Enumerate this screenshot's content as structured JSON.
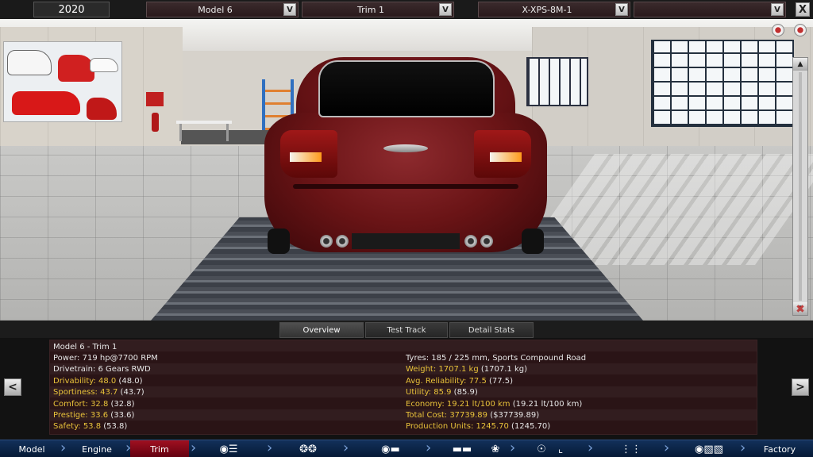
{
  "topbar": {
    "year": "2020",
    "model_select": "Model 6",
    "trim_select": "Trim 1",
    "engine_select": "X-XPS-8M-1",
    "extra_select": "",
    "dropdown_button": "V",
    "close_button": "X"
  },
  "tabs": [
    {
      "label": "Overview",
      "active": true
    },
    {
      "label": "Test Track",
      "active": false
    },
    {
      "label": "Detail Stats",
      "active": false
    }
  ],
  "stats": {
    "title": "Model 6 - Trim 1",
    "left": [
      {
        "label": "Power: ",
        "value": "719 hp@7700 RPM",
        "paren": "",
        "highlight": false
      },
      {
        "label": "Drivetrain: ",
        "value": "6 Gears RWD",
        "paren": "",
        "highlight": false
      },
      {
        "label": "Drivability: ",
        "value": "48.0",
        "paren": " (48.0)",
        "highlight": true
      },
      {
        "label": "Sportiness: ",
        "value": "43.7",
        "paren": " (43.7)",
        "highlight": true
      },
      {
        "label": "Comfort: ",
        "value": "32.8",
        "paren": " (32.8)",
        "highlight": true
      },
      {
        "label": "Prestige: ",
        "value": "33.6",
        "paren": " (33.6)",
        "highlight": true
      },
      {
        "label": "Safety: ",
        "value": "53.8",
        "paren": " (53.8)",
        "highlight": true
      }
    ],
    "right": [
      {
        "label": "Tyres: ",
        "value": "185 / 225 mm, Sports Compound Road",
        "paren": "",
        "highlight": false
      },
      {
        "label": "Weight: ",
        "value": "1707.1 kg",
        "paren": " (1707.1 kg)",
        "highlight": true
      },
      {
        "label": "Avg. Reliability: ",
        "value": "77.5",
        "paren": " (77.5)",
        "highlight": true
      },
      {
        "label": "Utility: ",
        "value": "85.9",
        "paren": " (85.9)",
        "highlight": true
      },
      {
        "label": "Economy: ",
        "value": "19.21 lt/100 km",
        "paren": " (19.21 lt/100 km)",
        "highlight": true
      },
      {
        "label": "Total Cost: ",
        "value": "37739.89",
        "paren": " ($37739.89)",
        "highlight": true
      },
      {
        "label": "Production Units: ",
        "value": "1245.70",
        "paren": " (1245.70)",
        "highlight": true
      }
    ]
  },
  "side_nav": {
    "prev": "<",
    "next": ">"
  },
  "bottomnav": {
    "model": "Model",
    "engine": "Engine",
    "trim": "Trim",
    "factory": "Factory",
    "icons": [
      "gearbox-icon",
      "wheels-icon",
      "body-icon",
      "car-profile-icon",
      "fan-icon",
      "steering-wheel-icon",
      "seat-icon",
      "suspension-icon",
      "test-drive-icon",
      "finish-flag-icon"
    ]
  },
  "colors": {
    "accent_red": "#a01020",
    "highlight_yellow": "#e8c23a",
    "nav_blue": "#12305a"
  }
}
